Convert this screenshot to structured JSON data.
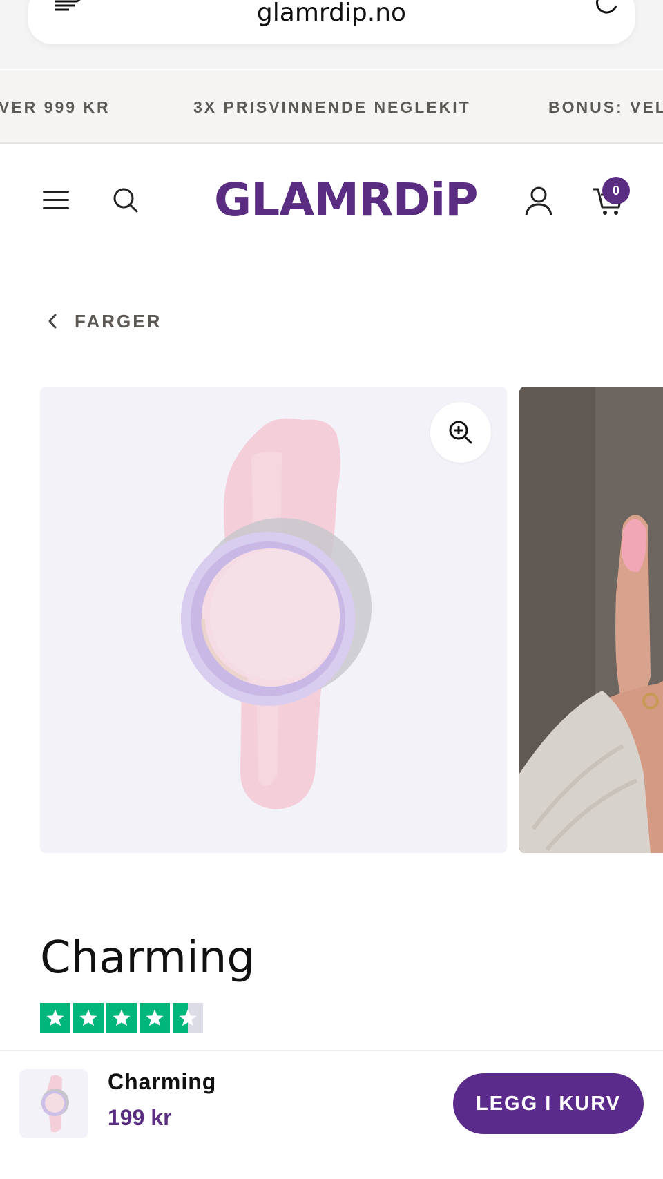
{
  "browser": {
    "url": "glamrdip.no"
  },
  "announcement": {
    "items": [
      "VER 999 KR",
      "3X PRISVINNENDE NEGLEKIT",
      "BONUS: VEL"
    ]
  },
  "header": {
    "logo_text": "GLAMRDiP",
    "cart_count": "0",
    "brand_color": "#5a2d82"
  },
  "breadcrumb": {
    "label": "FARGER"
  },
  "product": {
    "title": "Charming",
    "rating_stars": 4.5,
    "rating_color": "#00b67a",
    "swatch_color": "#f4cfd9"
  },
  "sticky": {
    "name": "Charming",
    "price": "199 kr",
    "button_label": "LEGG I KURV"
  },
  "icons": [
    "tabs-icon",
    "reload-icon",
    "menu-icon",
    "search-icon",
    "account-icon",
    "cart-icon",
    "chevron-left-icon",
    "zoom-in-icon",
    "star-icon"
  ]
}
